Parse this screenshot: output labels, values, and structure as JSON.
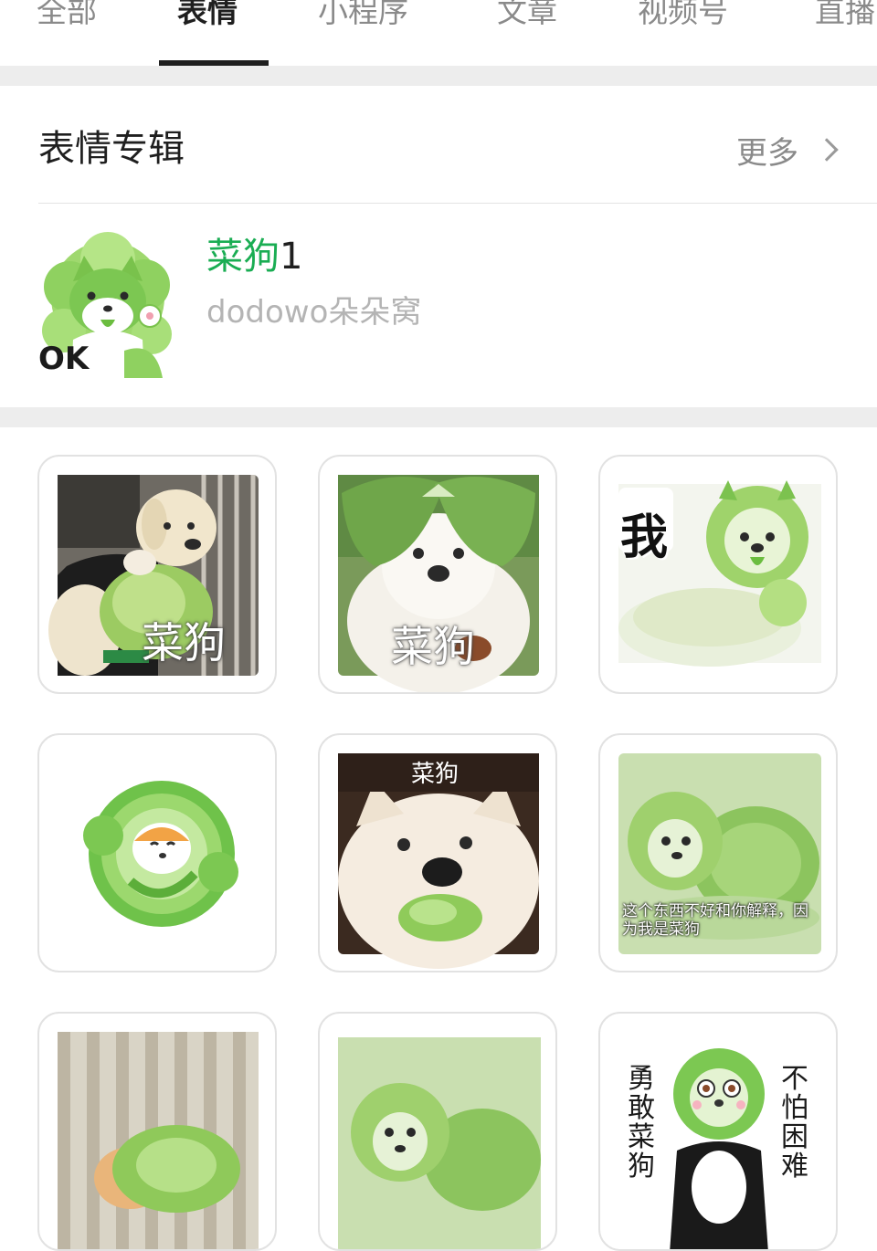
{
  "tabs": [
    "全部",
    "表情",
    "小程序",
    "文章",
    "视频号",
    "直播"
  ],
  "active_tab": "表情",
  "section": {
    "title": "表情专辑",
    "more_label": "更多"
  },
  "album": {
    "name_highlight": "菜狗",
    "name_suffix": "1",
    "author": "dodowo朵朵窝",
    "thumb_text": "OK"
  },
  "stickers": [
    {
      "caption": "菜狗"
    },
    {
      "caption": "菜狗"
    },
    {
      "caption": "我"
    },
    {
      "caption": ""
    },
    {
      "caption": "菜狗"
    },
    {
      "caption_line1": "这个东西不好和你解释，因",
      "caption_line2": "为我是菜狗"
    },
    {
      "caption": ""
    },
    {
      "caption": ""
    },
    {
      "caption_left": "勇敢菜狗",
      "caption_right": "不怕困难"
    }
  ],
  "colors": {
    "accent_green": "#1aad53",
    "text_primary": "#1f1f1f",
    "text_secondary": "#8a8a8a",
    "separator": "#ededed"
  }
}
